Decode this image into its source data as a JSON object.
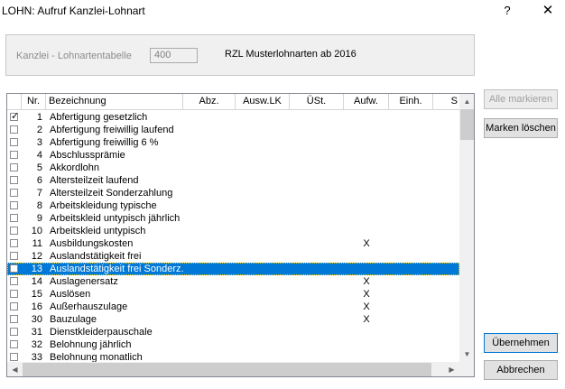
{
  "window": {
    "title": "LOHN: Aufruf Kanzlei-Lohnart",
    "help": "?",
    "close": "✕"
  },
  "kanzlei": {
    "label": "Kanzlei - Lohnartentabelle",
    "value": "400",
    "name": "RZL Musterlohnarten ab 2016"
  },
  "columns": [
    "Nr.",
    "Bezeichnung",
    "Abz.",
    "Ausw.LK",
    "ÜSt.",
    "Aufw.",
    "Einh.",
    "S"
  ],
  "rows": [
    {
      "nr": "1",
      "bez": "Abfertigung gesetzlich",
      "checked": true,
      "aufw": ""
    },
    {
      "nr": "2",
      "bez": "Abfertigung freiwillig laufend",
      "checked": false,
      "aufw": ""
    },
    {
      "nr": "3",
      "bez": "Abfertigung freiwillig 6 %",
      "checked": false,
      "aufw": ""
    },
    {
      "nr": "4",
      "bez": "Abschlussprämie",
      "checked": false,
      "aufw": ""
    },
    {
      "nr": "5",
      "bez": "Akkordlohn",
      "checked": false,
      "aufw": ""
    },
    {
      "nr": "6",
      "bez": "Altersteilzeit laufend",
      "checked": false,
      "aufw": ""
    },
    {
      "nr": "7",
      "bez": "Altersteilzeit Sonderzahlung",
      "checked": false,
      "aufw": ""
    },
    {
      "nr": "8",
      "bez": "Arbeitskleidung typische",
      "checked": false,
      "aufw": ""
    },
    {
      "nr": "9",
      "bez": "Arbeitskleid untypisch jährlich",
      "checked": false,
      "aufw": ""
    },
    {
      "nr": "10",
      "bez": "Arbeitskleid untypisch",
      "checked": false,
      "aufw": ""
    },
    {
      "nr": "11",
      "bez": "Ausbildungskosten",
      "checked": false,
      "aufw": "X"
    },
    {
      "nr": "12",
      "bez": "Auslandstätigkeit frei",
      "checked": false,
      "aufw": ""
    },
    {
      "nr": "13",
      "bez": "Auslandstätigkeit frei Sonderz.",
      "checked": false,
      "aufw": "",
      "selected": true
    },
    {
      "nr": "14",
      "bez": "Auslagenersatz",
      "checked": false,
      "aufw": "X"
    },
    {
      "nr": "15",
      "bez": "Auslösen",
      "checked": false,
      "aufw": "X"
    },
    {
      "nr": "16",
      "bez": "Außerhauszulage",
      "checked": false,
      "aufw": "X"
    },
    {
      "nr": "30",
      "bez": "Bauzulage",
      "checked": false,
      "aufw": "X"
    },
    {
      "nr": "31",
      "bez": "Dienstkleiderpauschale",
      "checked": false,
      "aufw": ""
    },
    {
      "nr": "32",
      "bez": "Belohnung jährlich",
      "checked": false,
      "aufw": ""
    },
    {
      "nr": "33",
      "bez": "Belohnung monatlich",
      "checked": false,
      "aufw": ""
    }
  ],
  "buttons": {
    "mark_all": "Alle markieren",
    "clear_marks": "Marken löschen",
    "accept": "Übernehmen",
    "cancel": "Abbrechen"
  },
  "colors": {
    "selection": "#0078d7",
    "focus_outline": "#f6d000"
  }
}
